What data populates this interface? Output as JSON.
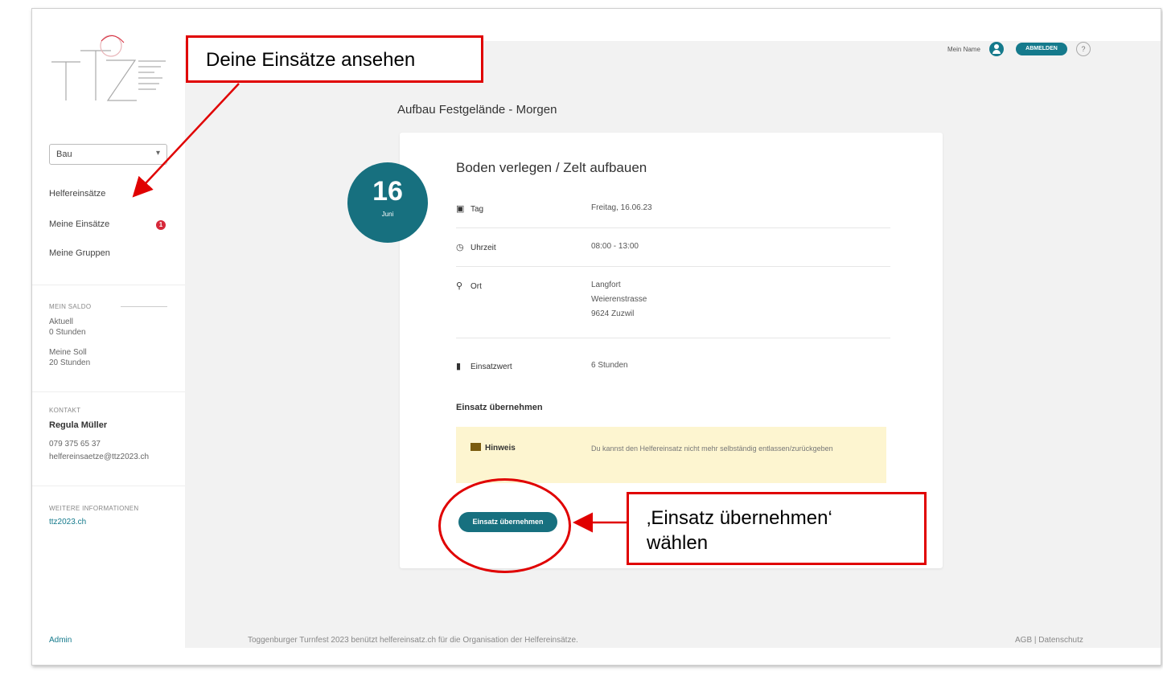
{
  "sidebar": {
    "select_value": "Bau",
    "nav": [
      {
        "label": "Helfereinsätze"
      },
      {
        "label": "Meine Einsätze",
        "badge": "1"
      },
      {
        "label": "Meine Gruppen"
      }
    ],
    "hours_header": "MEIN SALDO",
    "hours_current_label": "Aktuell",
    "hours_current_value": "0 Stunden",
    "hours_target_label": "Meine Soll",
    "hours_target_value": "20 Stunden",
    "contact_header": "KONTAKT",
    "contact_name": "Regula Müller",
    "contact_phone": "079 375 65 37",
    "contact_email": "helfereinsaetze@ttz2023.ch",
    "info_header": "WEITERE INFORMATIONEN",
    "info_link": "ttz2023.ch",
    "admin_link": "Admin"
  },
  "topbar": {
    "user_name": "Mein Name",
    "logout_label": "ABMELDEN",
    "help_label": "?"
  },
  "page": {
    "title": "Aufbau Festgelände - Morgen",
    "date_day": "16",
    "date_month": "Juni"
  },
  "card": {
    "title": "Boden verlegen / Zelt aufbauen",
    "rows": [
      {
        "icon": "calendar-icon",
        "label": "Tag",
        "value": "Freitag, 16.06.23"
      },
      {
        "icon": "clock-icon",
        "label": "Uhrzeit",
        "value": "08:00 - 13:00"
      },
      {
        "icon": "pin-icon",
        "label": "Ort",
        "value_lines": [
          "Langfort",
          "Weierenstrasse",
          "9624 Zuzwil"
        ]
      },
      {
        "icon": "bar-chart-icon",
        "label": "Einsatzwert",
        "value": "6 Stunden"
      }
    ],
    "section_title": "Einsatz übernehmen",
    "notice_label": "Hinweis",
    "notice_text": "Du kannst den Helfereinsatz nicht mehr selbständig entlassen/zurückgeben",
    "button_label": "Einsatz übernehmen"
  },
  "footer": {
    "center_text": "Toggenburger Turnfest 2023 benützt helfereinsatz.ch für die Organisation der Helfereinsätze.",
    "right_text": "AGB | Datenschutz"
  },
  "annotations": {
    "callout_1": "Deine Einsätze ansehen",
    "callout_2_line1": "‚Einsatz übernehmen‘",
    "callout_2_line2": "wählen",
    "accent_color": "#e00000"
  },
  "colors": {
    "brand": "#17707f",
    "badge": "#d6283a",
    "notice_bg": "#fdf5d0"
  }
}
